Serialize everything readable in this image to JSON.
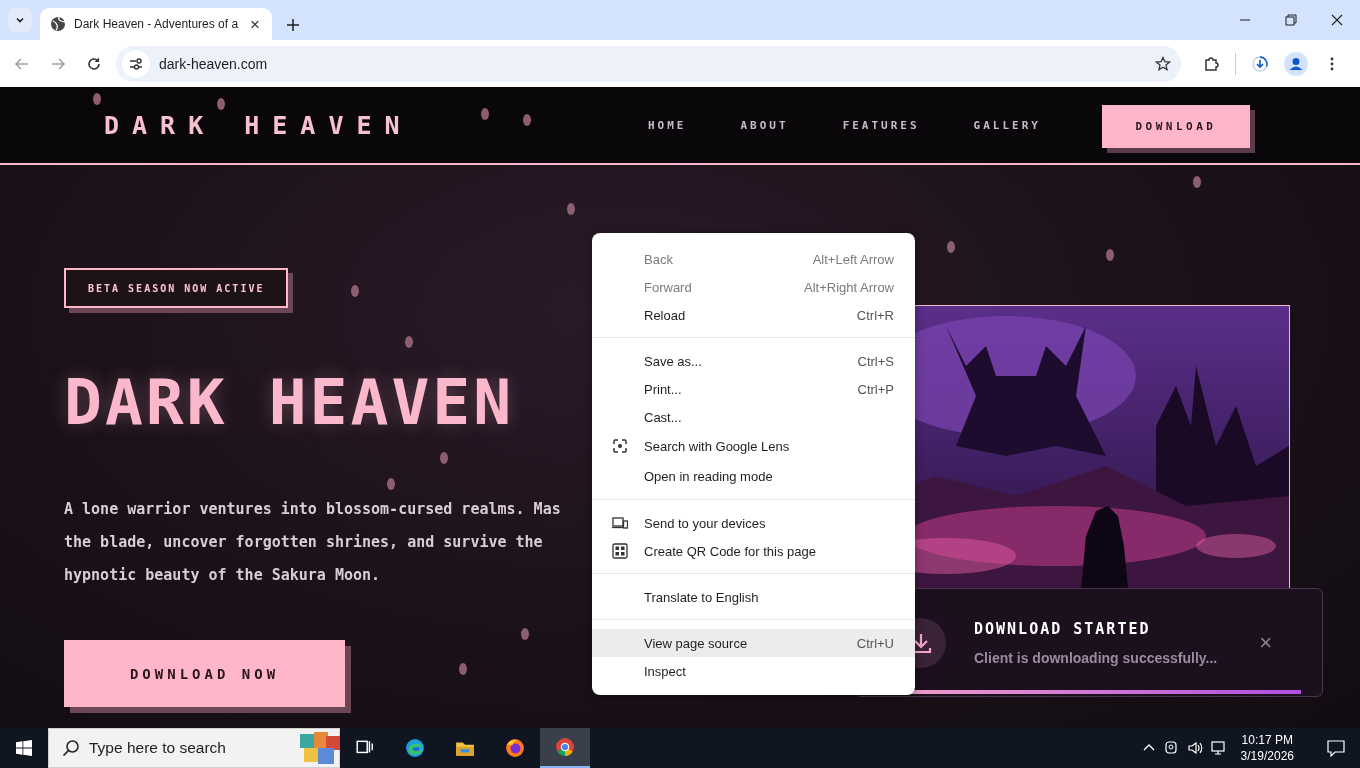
{
  "browser": {
    "tabs": [
      {
        "title": "Dark Heaven - Adventures of a",
        "close": "×",
        "selected": true
      }
    ],
    "url": "dark-heaven.com"
  },
  "site": {
    "logo": "DARK HEAVEN",
    "nav": [
      "HOME",
      "ABOUT",
      "FEATURES",
      "GALLERY"
    ],
    "cta": "DOWNLOAD"
  },
  "hero": {
    "badge": "BETA SEASON NOW ACTIVE",
    "title": "DARK HEAVEN",
    "description_lines": [
      "A lone warrior ventures into blossom-cursed realms. Mas",
      "the blade, uncover forgotten shrines, and survive the",
      "hypnotic beauty of the Sakura Moon."
    ],
    "button": "DOWNLOAD NOW",
    "artwork": {
      "kind": "picture"
    }
  },
  "toast": {
    "title": "DOWNLOAD STARTED",
    "message": "Client is downloading successfully...",
    "close": "×",
    "level": 0.98
  },
  "context_menu": {
    "items": [
      {
        "kind": "item",
        "label": "Back",
        "shortcut": "Alt+Left Arrow",
        "disabled": true,
        "highlighted": false
      },
      {
        "kind": "item",
        "label": "Forward",
        "shortcut": "Alt+Right Arrow",
        "disabled": true,
        "highlighted": false
      },
      {
        "kind": "item",
        "label": "Reload",
        "shortcut": "Ctrl+R",
        "disabled": false,
        "highlighted": false
      },
      {
        "kind": "separator"
      },
      {
        "kind": "item",
        "label": "Save as...",
        "shortcut": "Ctrl+S",
        "disabled": false,
        "highlighted": false
      },
      {
        "kind": "item",
        "label": "Print...",
        "shortcut": "Ctrl+P",
        "disabled": false,
        "highlighted": false
      },
      {
        "kind": "item",
        "label": "Cast...",
        "disabled": false,
        "highlighted": false
      },
      {
        "kind": "lens",
        "label": "Search with Google Lens",
        "disabled": false,
        "highlighted": false
      },
      {
        "kind": "item",
        "label": "Open in reading mode",
        "disabled": false,
        "highlighted": false
      },
      {
        "kind": "separator"
      },
      {
        "kind": "devices",
        "label": "Send to your devices",
        "disabled": false,
        "highlighted": false
      },
      {
        "kind": "qr",
        "label": "Create QR Code for this page",
        "disabled": false,
        "highlighted": false
      },
      {
        "kind": "separator"
      },
      {
        "kind": "item",
        "label": "Translate to English",
        "disabled": false,
        "highlighted": false
      },
      {
        "kind": "separator"
      },
      {
        "kind": "item",
        "label": "View page source",
        "shortcut": "Ctrl+U",
        "disabled": false,
        "highlighted": true
      },
      {
        "kind": "item",
        "label": "Inspect",
        "disabled": false,
        "highlighted": false
      }
    ]
  },
  "taskbar": {
    "search_placeholder": "Type here to search",
    "apps": [
      {
        "kind": "taskview",
        "active": false
      },
      {
        "kind": "edge",
        "active": false
      },
      {
        "kind": "explorer",
        "active": false
      },
      {
        "kind": "firefox",
        "active": false
      },
      {
        "kind": "chrome",
        "active": true
      }
    ],
    "time": "10:17 PM",
    "date": "3/19/2026"
  }
}
